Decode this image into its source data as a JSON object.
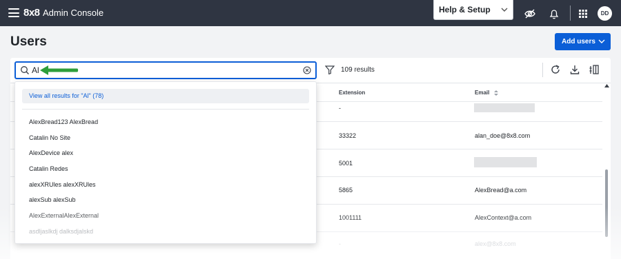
{
  "header": {
    "logo": "8x8",
    "app_title": "Admin Console",
    "help_label": "Help & Setup",
    "avatar_initials": "DD"
  },
  "page": {
    "title": "Users",
    "add_users_label": "Add users"
  },
  "search": {
    "value": "Al",
    "results_count": "109 results"
  },
  "dropdown": {
    "view_all": "View all results for \"Al\" (78)",
    "items": [
      "AlexBread123 AlexBread",
      "Catalin No Site",
      "AlexDevice alex",
      "Catalin Redes",
      "alexXRUles alexXRUles",
      "alexSub alexSub",
      "AlexExternalAlexExternal",
      "asdljaslkdj dalksdjalskd"
    ]
  },
  "table": {
    "columns": {
      "extension": "Extension",
      "email": "Email"
    },
    "rows": [
      {
        "extension": "-",
        "email": ""
      },
      {
        "extension": "33322",
        "email": "alan_doe@8x8.com"
      },
      {
        "extension": "5001",
        "email": ""
      },
      {
        "extension": "5865",
        "email": "AlexBread@a.com"
      },
      {
        "extension": "1001111",
        "email": "AlexContext@a.com"
      },
      {
        "extension": "-",
        "email": "alex@8x8.com"
      }
    ]
  },
  "colors": {
    "topbar": "#2f3542",
    "accent": "#0b5ed7",
    "arrow": "#2e9e3a"
  },
  "icons": [
    "menu-icon",
    "visibility-off-icon",
    "bell-icon",
    "apps-grid-icon",
    "search-icon",
    "clear-icon",
    "filter-icon",
    "refresh-icon",
    "download-icon",
    "column-settings-icon",
    "sort-icon"
  ]
}
